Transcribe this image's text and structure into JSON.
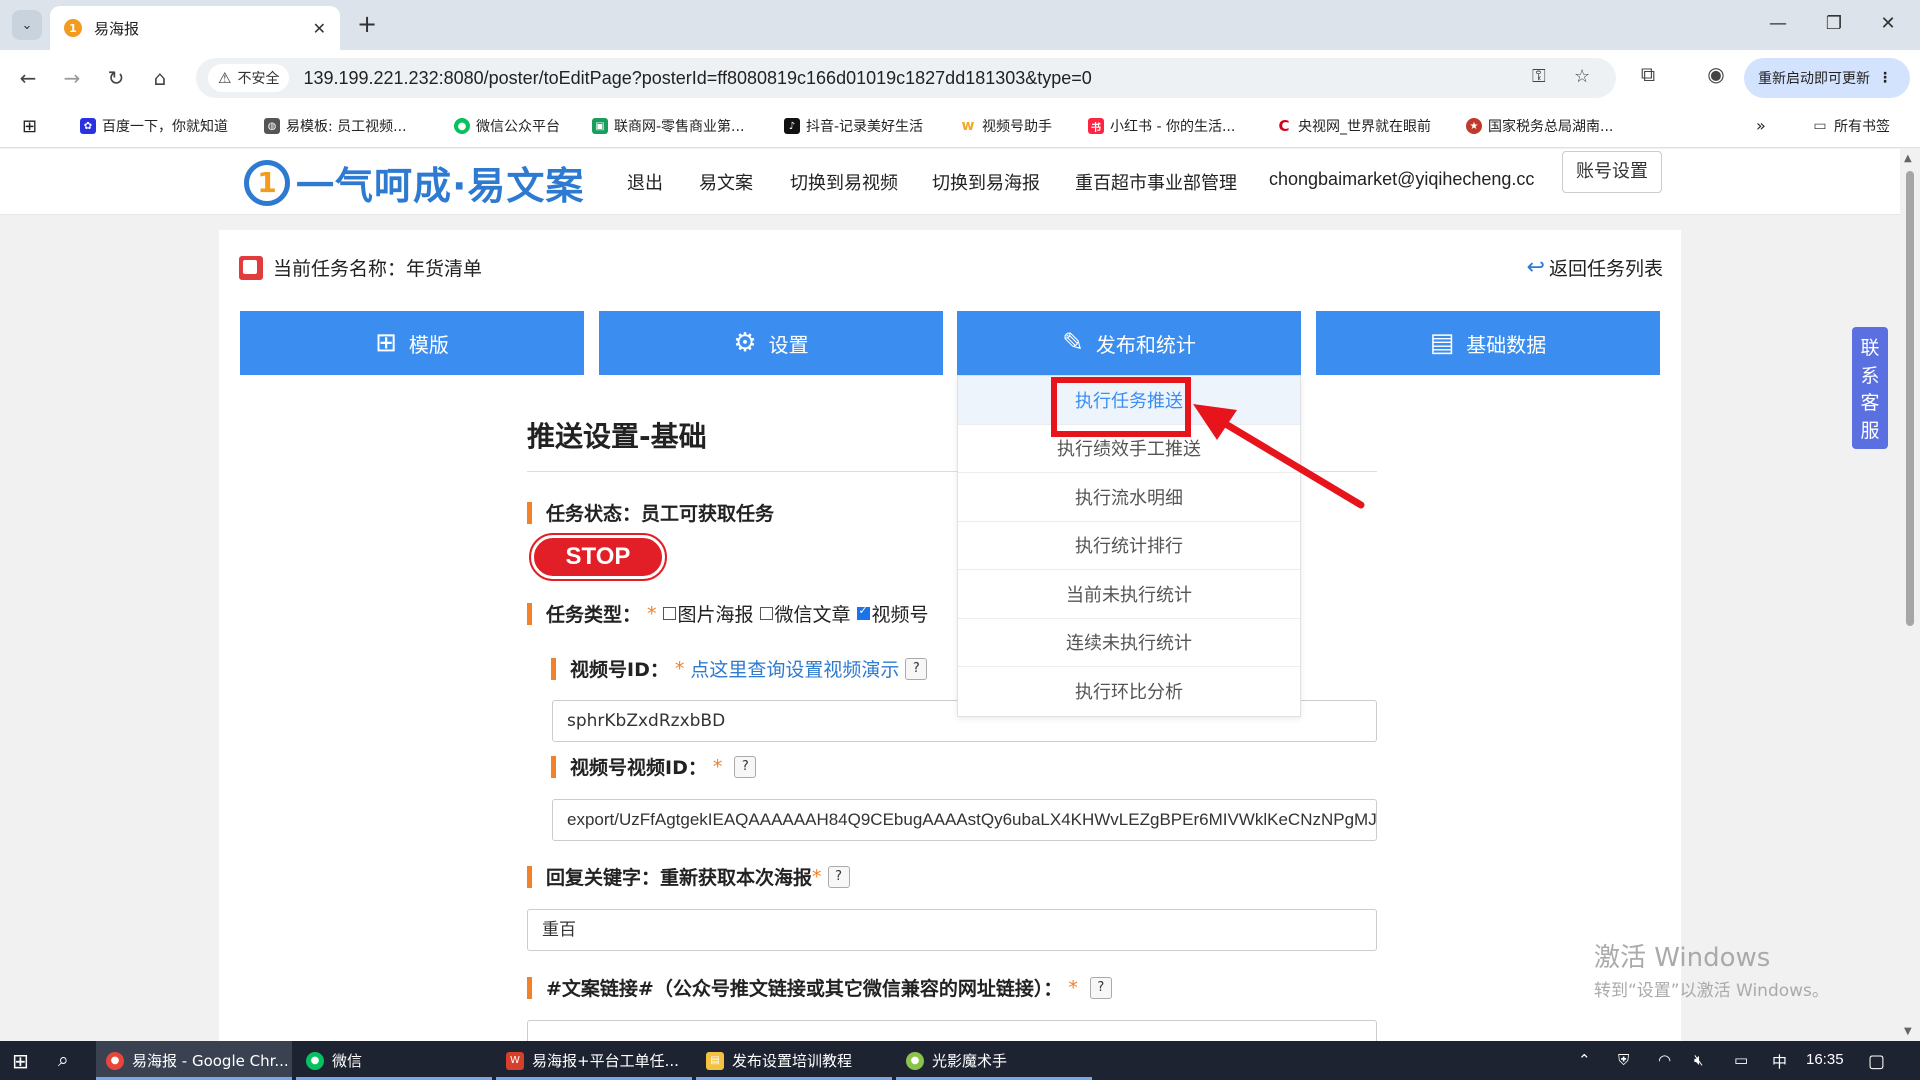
{
  "browser": {
    "tab_title": "易海报",
    "tab_favicon": "1",
    "url_security": "不安全",
    "url": "139.199.221.232:8080/poster/toEditPage?posterId=ff8080819c166d01019c1827dd181303&type=0",
    "update_label": "重新启动即可更新",
    "bookmarks": [
      {
        "label": "百度一下，你就知道",
        "color": "#2932e1"
      },
      {
        "label": "易模板: 员工视频...",
        "color": "#555555"
      },
      {
        "label": "微信公众平台",
        "color": "#07c160"
      },
      {
        "label": "联商网-零售商业第...",
        "color": "#1a9e5c"
      },
      {
        "label": "抖音-记录美好生活",
        "color": "#111111"
      },
      {
        "label": "视频号助手",
        "color": "#f5a623"
      },
      {
        "label": "小红书 - 你的生活...",
        "color": "#ff2442"
      },
      {
        "label": "央视网_世界就在眼前",
        "color": "#d0021b"
      },
      {
        "label": "国家税务总局湖南...",
        "color": "#c0392b"
      }
    ],
    "all_bookmarks": "所有书签"
  },
  "site": {
    "logo_mark": "1",
    "logo_text": "一气呵成·易文案",
    "nav": [
      "退出",
      "易文案",
      "切换到易视频",
      "切换到易海报",
      "重百超市事业部管理",
      "chongbaimarket@yiqihecheng.cc"
    ],
    "account_button": "账号设置"
  },
  "task": {
    "name": "当前任务名称：年货清单",
    "back": "返回任务列表"
  },
  "tabs": [
    {
      "label": "模版",
      "icon": "⊞"
    },
    {
      "label": "设置",
      "icon": "⚙"
    },
    {
      "label": "发布和统计",
      "icon": "✎"
    },
    {
      "label": "基础数据",
      "icon": "▤"
    }
  ],
  "dropdown": [
    "执行任务推送",
    "执行绩效手工推送",
    "执行流水明细",
    "执行统计排行",
    "当前未执行统计",
    "连续未执行统计",
    "执行环比分析"
  ],
  "form": {
    "title": "推送设置-基础",
    "status_label": "任务状态：",
    "status_value": "员工可获取任务",
    "stop_label": "STOP",
    "type_label": "任务类型：",
    "type_options": [
      {
        "label": "图片海报",
        "checked": false
      },
      {
        "label": "微信文章",
        "checked": false
      },
      {
        "label": "视频号",
        "checked": true
      }
    ],
    "channel_label": "视频号ID：",
    "channel_link": "点这里查询设置视频演示",
    "channel_value": "sphrKbZxdRzxbBD",
    "video_label": "视频号视频ID：",
    "video_value": "export/UzFfAgtgekIEAQAAAAAAH84Q9CEbugAAAAstQy6ubaLX4KHWvLEZgBPEr6MIVWklKeCNzNPgMJp",
    "reply_label": "回复关键字：重新获取本次海报",
    "reply_value": "重百",
    "link_label": "#文案链接#（公众号推文链接或其它微信兼容的网址链接）："
  },
  "help_mark": "?",
  "required_mark": "*",
  "service": [
    "联",
    "系",
    "客",
    "服"
  ],
  "watermark": {
    "line1": "激活 Windows",
    "line2": "转到“设置”以激活 Windows。"
  },
  "taskbar": {
    "items": [
      {
        "label": "易海报 - Google Chr...",
        "color": "#e8453c",
        "active": true
      },
      {
        "label": "微信",
        "color": "#07c160",
        "active": false
      },
      {
        "label": "易海报+平台工单任...",
        "color": "#d4402b",
        "active": false
      },
      {
        "label": "发布设置培训教程",
        "color": "#f3c242",
        "active": false
      },
      {
        "label": "光影魔术手",
        "color": "#8bc34a",
        "active": false
      }
    ],
    "ime": "中",
    "time": "16:35"
  }
}
